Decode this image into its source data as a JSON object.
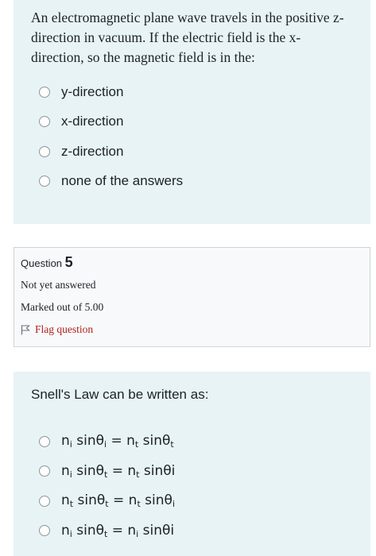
{
  "question4": {
    "text": "An electromagnetic plane wave travels in the positive z-direction in vacuum. If the electric field is the x-direction, so the magnetic field is in the:",
    "options": [
      "y-direction",
      "x-direction",
      "z-direction",
      "none of the answers"
    ]
  },
  "question5_info": {
    "label": "Question",
    "number": "5",
    "status": "Not yet answered",
    "marks": "Marked out of 5.00",
    "flag": "Flag question"
  },
  "question5": {
    "text": "Snell's Law can be written as:",
    "options": [
      {
        "a": "n",
        "a_sub": "i",
        "b": " sinθ",
        "b_sub": "i",
        "c": " = n",
        "c_sub": "t",
        "d": " sinθ",
        "d_sub": "t"
      },
      {
        "a": "n",
        "a_sub": "i",
        "b": " sinθ",
        "b_sub": "t",
        "c": " = n",
        "c_sub": "t",
        "d": " sinθi",
        "d_sub": ""
      },
      {
        "a": "n",
        "a_sub": "t",
        "b": " sinθ",
        "b_sub": "t",
        "c": " = n",
        "c_sub": "t",
        "d": " sinθ",
        "d_sub": "i"
      },
      {
        "a": "n",
        "a_sub": "i",
        "b": " sinθ",
        "b_sub": "t",
        "c": " = n",
        "c_sub": "i",
        "d": " sinθi",
        "d_sub": ""
      }
    ]
  },
  "colors": {
    "panel_bg": "#e7f3f5",
    "info_bg": "#f8f9fa",
    "flag_red": "#b0201d"
  }
}
